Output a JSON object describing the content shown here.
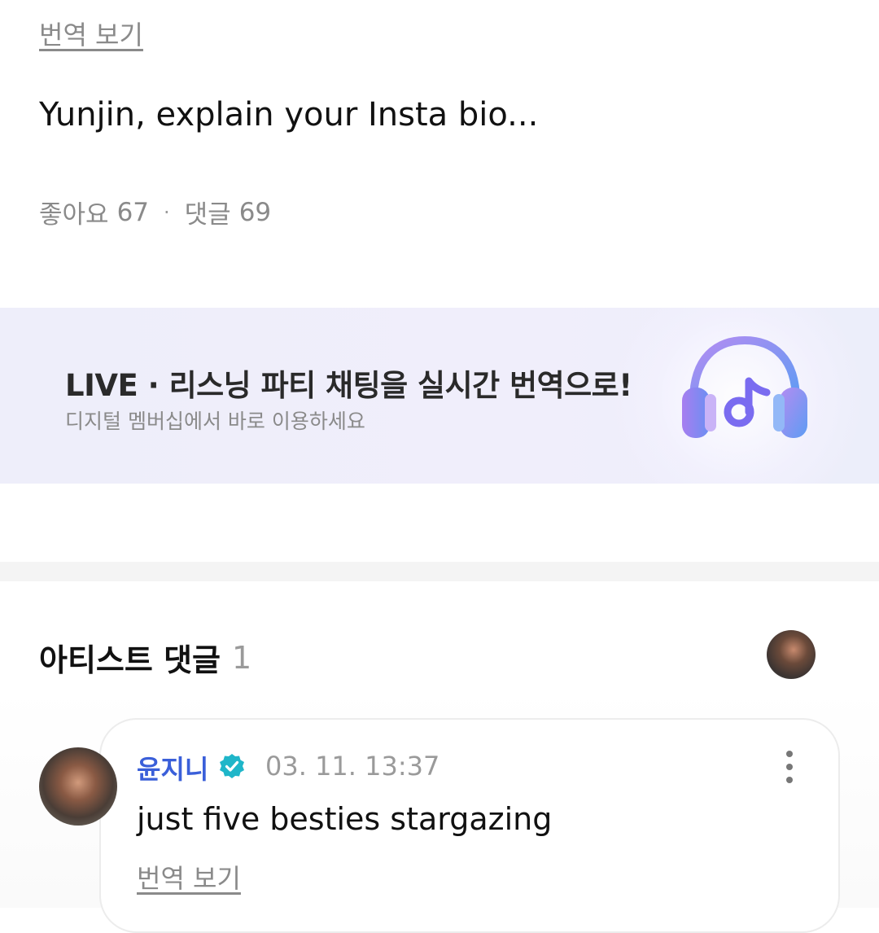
{
  "post": {
    "translate_link": "번역 보기",
    "text": "Yunjin, explain your Insta bio...",
    "likes_label": "좋아요",
    "likes_count": "67",
    "separator": "·",
    "comments_label": "댓글",
    "comments_count": "69"
  },
  "banner": {
    "title": "LIVE · 리스닝 파티 채팅을 실시간 번역으로!",
    "subtitle": "디지털 멤버십에서 바로 이용하세요",
    "icon": "headphones-music-icon",
    "accent_colors": [
      "#9d7bf0",
      "#6aa3f5"
    ]
  },
  "artist_comments": {
    "title": "아티스트 댓글",
    "count": "1"
  },
  "comment": {
    "author": "윤지니",
    "verified_color": "#1fb6c9",
    "date": "03. 11. 13:37",
    "text": "just five besties stargazing",
    "translate_link": "번역 보기"
  },
  "colors": {
    "author_name": "#3a5fd9",
    "muted": "#8a8a8a"
  }
}
